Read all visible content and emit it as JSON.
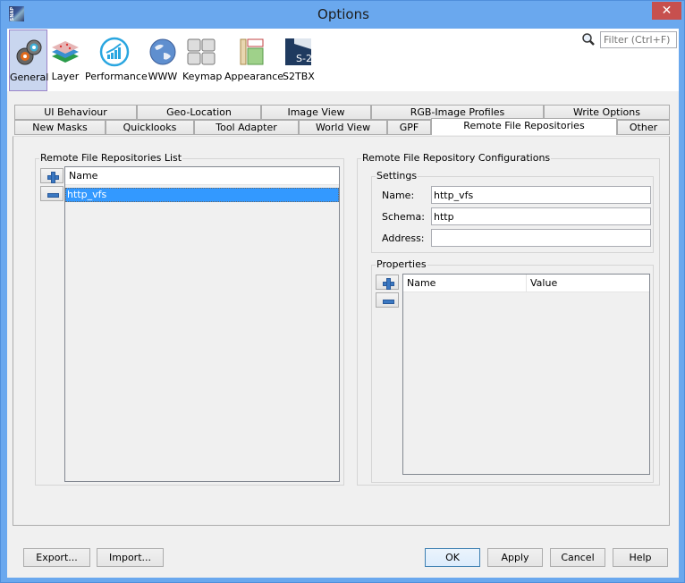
{
  "window": {
    "title": "Options",
    "app_icon_text": "SNAP",
    "close_glyph": "✕"
  },
  "toolbar": {
    "categories": [
      {
        "label": "General",
        "icon": "gears-icon",
        "selected": true
      },
      {
        "label": "Layer",
        "icon": "layers-icon",
        "selected": false
      },
      {
        "label": "Performance",
        "icon": "performance-chart-icon",
        "selected": false
      },
      {
        "label": "WWW",
        "icon": "globe-icon",
        "selected": false
      },
      {
        "label": "Keymap",
        "icon": "keyboard-keys-icon",
        "selected": false
      },
      {
        "label": "Appearance",
        "icon": "appearance-layout-icon",
        "selected": false
      },
      {
        "label": "S2TBX",
        "icon": "snap-s2-icon",
        "selected": false
      }
    ],
    "filter_placeholder": "Filter (Ctrl+F)"
  },
  "tabs": {
    "row_top": [
      "UI Behaviour",
      "Geo-Location",
      "Image View",
      "RGB-Image Profiles",
      "Write Options"
    ],
    "row_bottom": [
      "New Masks",
      "Quicklooks",
      "Tool Adapter",
      "World View",
      "GPF",
      "Remote File Repositories",
      "Other"
    ],
    "active": "Remote File Repositories"
  },
  "repo_list": {
    "title": "Remote File Repositories List",
    "column": "Name",
    "rows": [
      "http_vfs"
    ],
    "selected_row": "http_vfs"
  },
  "config": {
    "title": "Remote File Repository Configurations",
    "settings": {
      "title": "Settings",
      "name_label": "Name:",
      "name_value": "http_vfs",
      "schema_label": "Schema:",
      "schema_value": "http",
      "address_label": "Address:",
      "address_value": ""
    },
    "properties": {
      "title": "Properties",
      "columns": [
        "Name",
        "Value"
      ],
      "rows": []
    }
  },
  "buttons": {
    "export": "Export...",
    "import": "Import...",
    "ok": "OK",
    "apply": "Apply",
    "cancel": "Cancel",
    "help": "Help"
  },
  "colors": {
    "titlebar": "#6aa8ee",
    "close": "#c7504e",
    "selection": "#3399ff",
    "plus_minus": "#3a78c2"
  }
}
